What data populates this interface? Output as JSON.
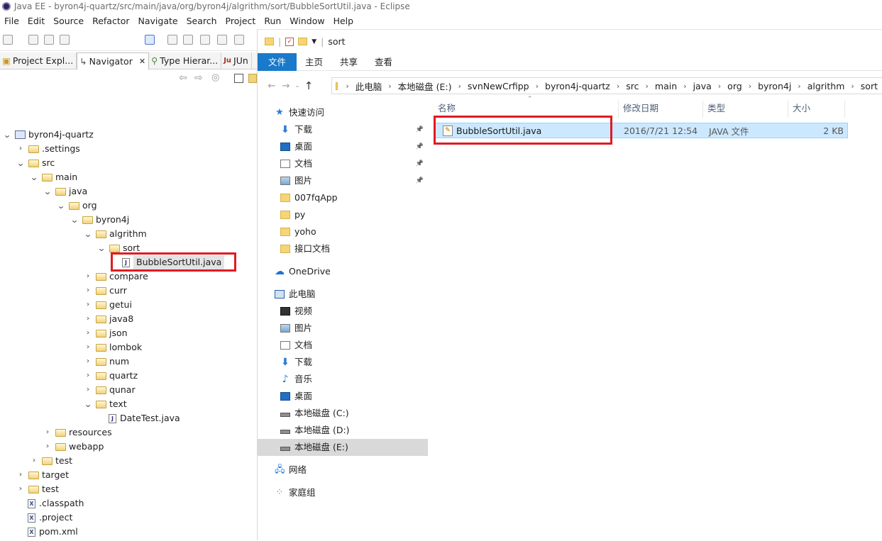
{
  "eclipse": {
    "title": "Java EE - byron4j-quartz/src/main/java/org/byron4j/algrithm/sort/BubbleSortUtil.java - Eclipse",
    "menu": [
      "File",
      "Edit",
      "Source",
      "Refactor",
      "Navigate",
      "Search",
      "Project",
      "Run",
      "Window",
      "Help"
    ],
    "tabs": [
      "Project Expl...",
      "Navigator",
      "Type Hierar...",
      "JUn"
    ],
    "tree": [
      {
        "label": "byron4j-quartz",
        "depth": 0,
        "type": "project",
        "open": true
      },
      {
        "label": ".settings",
        "depth": 1,
        "type": "folder",
        "open": false
      },
      {
        "label": "src",
        "depth": 1,
        "type": "folder",
        "open": true
      },
      {
        "label": "main",
        "depth": 2,
        "type": "folder",
        "open": true
      },
      {
        "label": "java",
        "depth": 3,
        "type": "folder",
        "open": true
      },
      {
        "label": "org",
        "depth": 4,
        "type": "folder",
        "open": true
      },
      {
        "label": "byron4j",
        "depth": 5,
        "type": "folder",
        "open": true
      },
      {
        "label": "algrithm",
        "depth": 6,
        "type": "folder",
        "open": true
      },
      {
        "label": "sort",
        "depth": 7,
        "type": "folder",
        "open": true
      },
      {
        "label": "BubbleSortUtil.java",
        "depth": 8,
        "type": "java",
        "selected": true
      },
      {
        "label": "compare",
        "depth": 6,
        "type": "folder",
        "open": false
      },
      {
        "label": "curr",
        "depth": 6,
        "type": "folder",
        "open": false
      },
      {
        "label": "getui",
        "depth": 6,
        "type": "folder",
        "open": false
      },
      {
        "label": "java8",
        "depth": 6,
        "type": "folder",
        "open": false
      },
      {
        "label": "json",
        "depth": 6,
        "type": "folder",
        "open": false
      },
      {
        "label": "lombok",
        "depth": 6,
        "type": "folder",
        "open": false
      },
      {
        "label": "num",
        "depth": 6,
        "type": "folder",
        "open": false
      },
      {
        "label": "quartz",
        "depth": 6,
        "type": "folder",
        "open": false
      },
      {
        "label": "qunar",
        "depth": 6,
        "type": "folder",
        "open": false
      },
      {
        "label": "text",
        "depth": 6,
        "type": "folder",
        "open": true
      },
      {
        "label": "DateTest.java",
        "depth": 7,
        "type": "java"
      },
      {
        "label": "resources",
        "depth": 3,
        "type": "folder",
        "open": false
      },
      {
        "label": "webapp",
        "depth": 3,
        "type": "folder",
        "open": false
      },
      {
        "label": "test",
        "depth": 2,
        "type": "folder",
        "open": false
      },
      {
        "label": "target",
        "depth": 1,
        "type": "folder",
        "open": false
      },
      {
        "label": "test",
        "depth": 1,
        "type": "folder",
        "open": false
      },
      {
        "label": ".classpath",
        "depth": 1,
        "type": "xml"
      },
      {
        "label": ".project",
        "depth": 1,
        "type": "xml"
      },
      {
        "label": "pom.xml",
        "depth": 1,
        "type": "xml"
      }
    ]
  },
  "explorer": {
    "window_title": "sort",
    "ribbon_tabs": [
      "文件",
      "主页",
      "共享",
      "查看"
    ],
    "breadcrumb": [
      "此电脑",
      "本地磁盘 (E:)",
      "svnNewCrfipp",
      "byron4j-quartz",
      "src",
      "main",
      "java",
      "org",
      "byron4j",
      "algrithm",
      "sort"
    ],
    "nav_items": [
      {
        "label": "快速访问",
        "icon": "star-icon",
        "indent": 0,
        "pinned": false
      },
      {
        "label": "下载",
        "icon": "download-icon",
        "indent": 1,
        "pinned": true
      },
      {
        "label": "桌面",
        "icon": "desktop-icon",
        "indent": 1,
        "pinned": true
      },
      {
        "label": "文档",
        "icon": "document-icon",
        "indent": 1,
        "pinned": true
      },
      {
        "label": "图片",
        "icon": "pictures-icon",
        "indent": 1,
        "pinned": true
      },
      {
        "label": "007fqApp",
        "icon": "folder-icon",
        "indent": 1,
        "pinned": false
      },
      {
        "label": "py",
        "icon": "folder-icon",
        "indent": 1,
        "pinned": false
      },
      {
        "label": "yoho",
        "icon": "folder-icon",
        "indent": 1,
        "pinned": false
      },
      {
        "label": "接口文档",
        "icon": "folder-icon",
        "indent": 1,
        "pinned": false
      },
      {
        "label": "OneDrive",
        "icon": "cloud-icon",
        "indent": 0,
        "pinned": false,
        "gap": true
      },
      {
        "label": "此电脑",
        "icon": "computer-icon",
        "indent": 0,
        "pinned": false,
        "gap": true
      },
      {
        "label": "视频",
        "icon": "video-icon",
        "indent": 1,
        "pinned": false
      },
      {
        "label": "图片",
        "icon": "pictures-icon",
        "indent": 1,
        "pinned": false
      },
      {
        "label": "文档",
        "icon": "document-icon",
        "indent": 1,
        "pinned": false
      },
      {
        "label": "下载",
        "icon": "download-icon",
        "indent": 1,
        "pinned": false
      },
      {
        "label": "音乐",
        "icon": "music-icon",
        "indent": 1,
        "pinned": false
      },
      {
        "label": "桌面",
        "icon": "desktop-icon",
        "indent": 1,
        "pinned": false
      },
      {
        "label": "本地磁盘 (C:)",
        "icon": "drive-icon",
        "indent": 1,
        "pinned": false
      },
      {
        "label": "本地磁盘 (D:)",
        "icon": "drive-icon",
        "indent": 1,
        "pinned": false
      },
      {
        "label": "本地磁盘 (E:)",
        "icon": "drive-icon",
        "indent": 1,
        "pinned": false,
        "selected": true
      },
      {
        "label": "网络",
        "icon": "network-icon",
        "indent": 0,
        "pinned": false,
        "gap": true
      },
      {
        "label": "家庭组",
        "icon": "homegroup-icon",
        "indent": 0,
        "pinned": false,
        "gap": true
      }
    ],
    "columns": [
      "名称",
      "修改日期",
      "类型",
      "大小"
    ],
    "files": [
      {
        "name": "BubbleSortUtil.java",
        "modified": "2016/7/21 12:54",
        "type": "JAVA 文件",
        "size": "2 KB"
      }
    ]
  },
  "colors": {
    "highlight": "#e01b22",
    "selection": "#cce8ff",
    "ribbon_file": "#1979ca"
  }
}
